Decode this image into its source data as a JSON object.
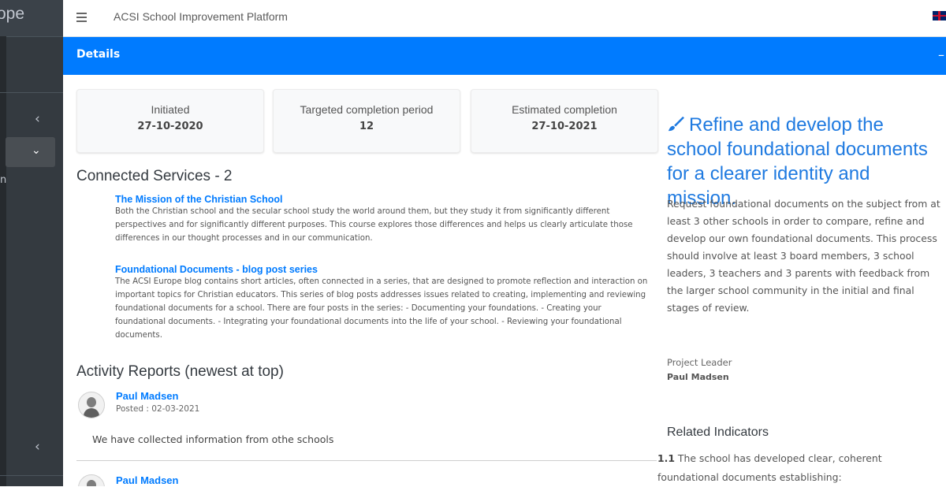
{
  "app": {
    "brand_fragment": "ope",
    "title": "ACSI School Improvement Platform"
  },
  "card": {
    "header": "Details",
    "tool_icon": "minus-icon"
  },
  "info_boxes": [
    {
      "label": "Initiated",
      "value": "27-10-2020"
    },
    {
      "label": "Targeted completion period",
      "value": "12"
    },
    {
      "label": "Estimated completion",
      "value": "27-10-2021"
    }
  ],
  "connected_services": {
    "title": "Connected Services - 2",
    "items": [
      {
        "title": "The Mission of the Christian School",
        "lines": [
          "Both the Christian school and the secular school study the world around them, but they study it from significantly different",
          "perspectives and for significantly different purposes. This course explores those differences and helps us clearly articulate those",
          "differences in our thought processes and in our communication."
        ]
      },
      {
        "title": "Foundational Documents - blog post series",
        "lines": [
          "The ACSI Europe blog contains short articles, often connected in a series, that are designed to promote reflection and interaction on",
          "important topics for Christian educators. This series of blog posts addresses issues related to creating, implementing and reviewing",
          "foundational documents for a school. There are four posts in the series: - Documenting your foundations. - Creating your",
          "foundational documents. - Integrating your foundational documents into the life of your school. - Reviewing your foundational",
          "documents."
        ]
      }
    ]
  },
  "activity_reports": {
    "title": "Activity Reports (newest at top)",
    "items": [
      {
        "author": "Paul Madsen",
        "posted": "Posted : 02-03-2021",
        "message": "We have collected information from othe schools"
      },
      {
        "author": "Paul Madsen"
      }
    ]
  },
  "project": {
    "title_lines": [
      "Refine and develop the",
      "school foundational documents",
      "for a clearer identity and",
      "mission."
    ],
    "icon": "paint-brush-icon",
    "description_lines": [
      "Request foundational documents on the subject from at",
      "least 3 other schools in order to compare, refine and",
      "develop our own foundational documents. This process",
      "should involve at least 3 board members, 3 school",
      "leaders, 3 teachers and 3 parents with feedback from",
      "the larger school community in the initial and final",
      "stages of review."
    ],
    "leader_label": "Project Leader",
    "leader_name": "Paul Madsen",
    "related_title": "Related Indicators",
    "indicator_number": "1.1",
    "indicator_lines": [
      "The school has developed clear, coherent",
      "foundational documents establishing:"
    ]
  },
  "colors": {
    "accent": "#007bff",
    "sidebar": "#343a40",
    "title_blue": "#1f7ae0"
  }
}
